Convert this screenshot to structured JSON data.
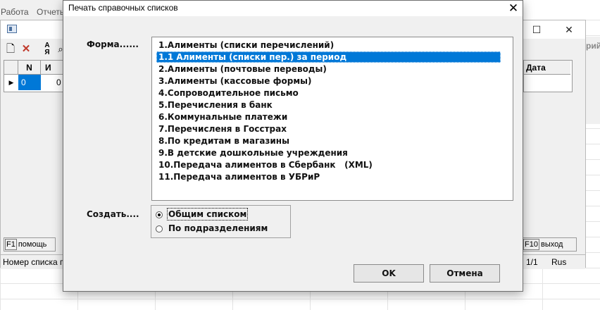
{
  "background_app": {
    "menu": [
      "Работа",
      "Отчеты"
    ],
    "table_headers": {
      "n": "N",
      "i": "И"
    },
    "row": {
      "n": "0",
      "i": "0"
    },
    "right_header": "Дата",
    "partial_right_text": "рий",
    "f1_key": "F1",
    "f1_label": "помощь",
    "f10_key": "F10",
    "f10_label": "выход",
    "status_left": "Номер списка п",
    "status_page": "1/1",
    "status_lang": "Rus"
  },
  "dialog": {
    "title": "Печать справочных списков",
    "form_label": "Форма......",
    "create_label": "Создать....",
    "list_items": [
      "1.Алименты (списки перечислений)",
      "1.1 Алименты (списки пер.) за период",
      "2.Алименты (почтовые переводы)",
      "3.Алименты (кассовые формы)",
      "4.Сопроводительное письмо",
      "5.Перечисления в банк",
      "6.Коммунальные платежи",
      "7.Перечисленя в Госстрах",
      "8.По кредитам в магазины",
      "9.В детские дошкольные учреждения",
      "10.Передача алиментов в Сбербанк   (XML)",
      "11.Передача алиментов в УБРиР"
    ],
    "selected_index": 1,
    "radio_options": [
      "Общим списком",
      "По подразделениям"
    ],
    "radio_selected": 0,
    "ok_label": "OK",
    "cancel_label": "Отмена"
  },
  "colors": {
    "selection": "#0078d7",
    "dialog_bg": "#f0f0f0"
  }
}
